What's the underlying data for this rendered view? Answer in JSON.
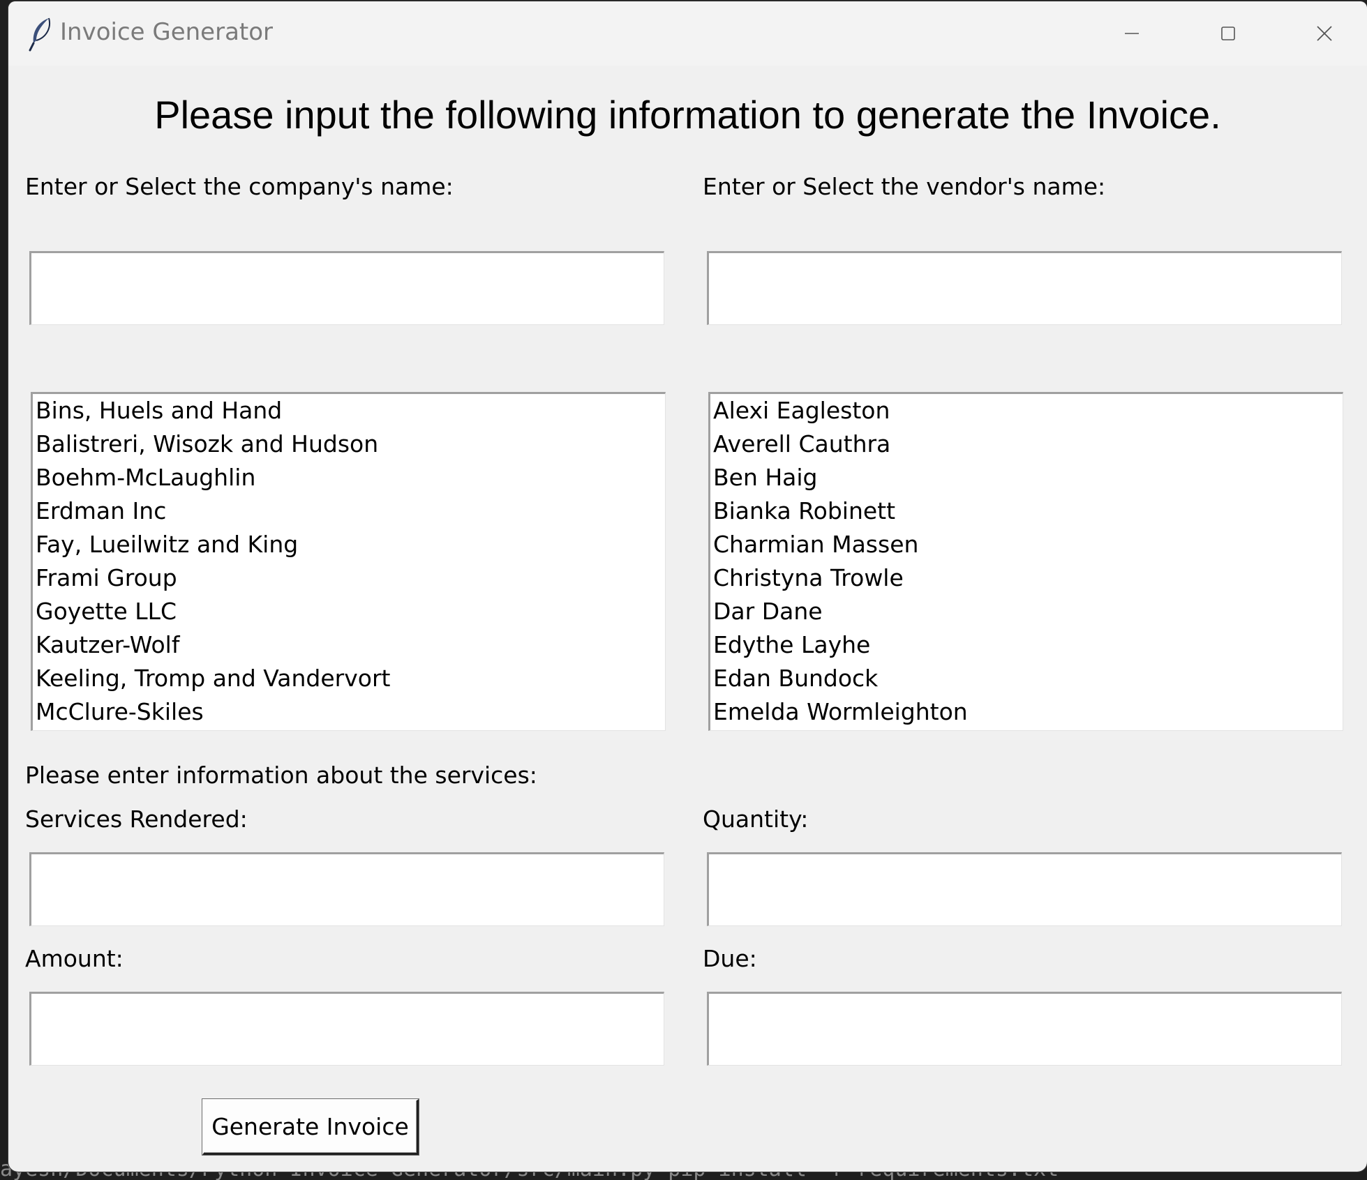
{
  "window": {
    "title": "Invoice Generator"
  },
  "heading": "Please input the following information to generate the Invoice.",
  "company": {
    "label": "Enter or Select the company's name:",
    "value": "",
    "options": [
      "Bins, Huels and Hand",
      "Balistreri, Wisozk and Hudson",
      "Boehm-McLaughlin",
      "Erdman Inc",
      "Fay, Lueilwitz and King",
      "Frami Group",
      "Goyette LLC",
      "Kautzer-Wolf",
      "Keeling, Tromp and Vandervort",
      "McClure-Skiles"
    ]
  },
  "vendor": {
    "label": "Enter or Select the vendor's name:",
    "value": "",
    "options": [
      "Alexi Eagleston",
      "Averell Cauthra",
      "Ben Haig",
      "Bianka Robinett",
      "Charmian Massen",
      "Christyna Trowle",
      "Dar Dane",
      "Edythe Layhe",
      "Edan Bundock",
      "Emelda Wormleighton"
    ]
  },
  "services": {
    "section_label": "Please enter information about the services:",
    "services_rendered_label": "Services Rendered:",
    "services_rendered_value": "",
    "quantity_label": "Quantity:",
    "quantity_value": "",
    "amount_label": "Amount:",
    "amount_value": "",
    "due_label": "Due:",
    "due_value": ""
  },
  "generate_button_label": "Generate Invoice",
  "terminal_text": "ayesh/Documents/Python Invoice Generator/src/main.py pip install -r requirements.txt",
  "colors": {
    "window_bg": "#f0f0f0",
    "titlebar_bg": "#f3f3f3",
    "field_bg": "#ffffff",
    "field_border": "#a0a0a0"
  }
}
